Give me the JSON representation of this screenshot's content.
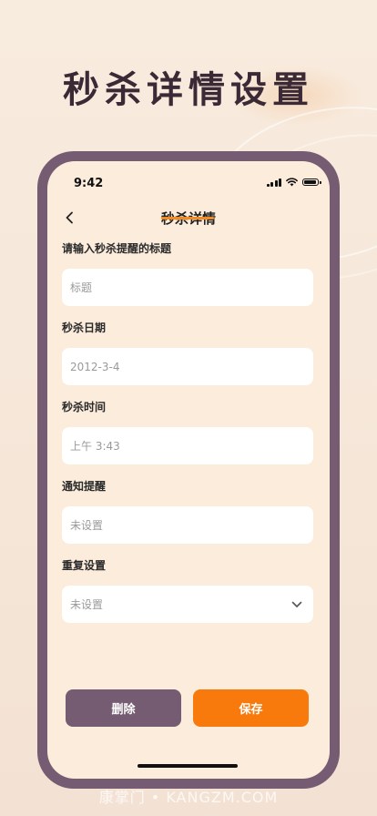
{
  "page_title": "秒杀详情设置",
  "status_bar": {
    "time": "9:42"
  },
  "nav": {
    "title": "秒杀详情",
    "accent": "#f58a1f"
  },
  "form": {
    "fields": [
      {
        "label": "请输入秒杀提醒的标题",
        "value": "标题",
        "is_placeholder": true
      },
      {
        "label": "秒杀日期",
        "value": "2012-3-4",
        "is_placeholder": false
      },
      {
        "label": "秒杀时间",
        "value": "上午 3:43",
        "is_placeholder": false
      },
      {
        "label": "通知提醒",
        "value": "未设置",
        "is_placeholder": false
      },
      {
        "label": "重复设置",
        "value": "未设置",
        "is_placeholder": false,
        "has_dropdown": true
      }
    ]
  },
  "buttons": {
    "delete_label": "删除",
    "save_label": "保存",
    "delete_color": "#765c72",
    "save_color": "#f97a0c"
  },
  "watermark": "康掌门 • KANGZM.COM",
  "icons": {
    "back": "chevron-left-icon",
    "dropdown": "chevron-down-icon",
    "signal": "cellular-signal-icon",
    "wifi": "wifi-icon",
    "battery": "battery-icon"
  }
}
